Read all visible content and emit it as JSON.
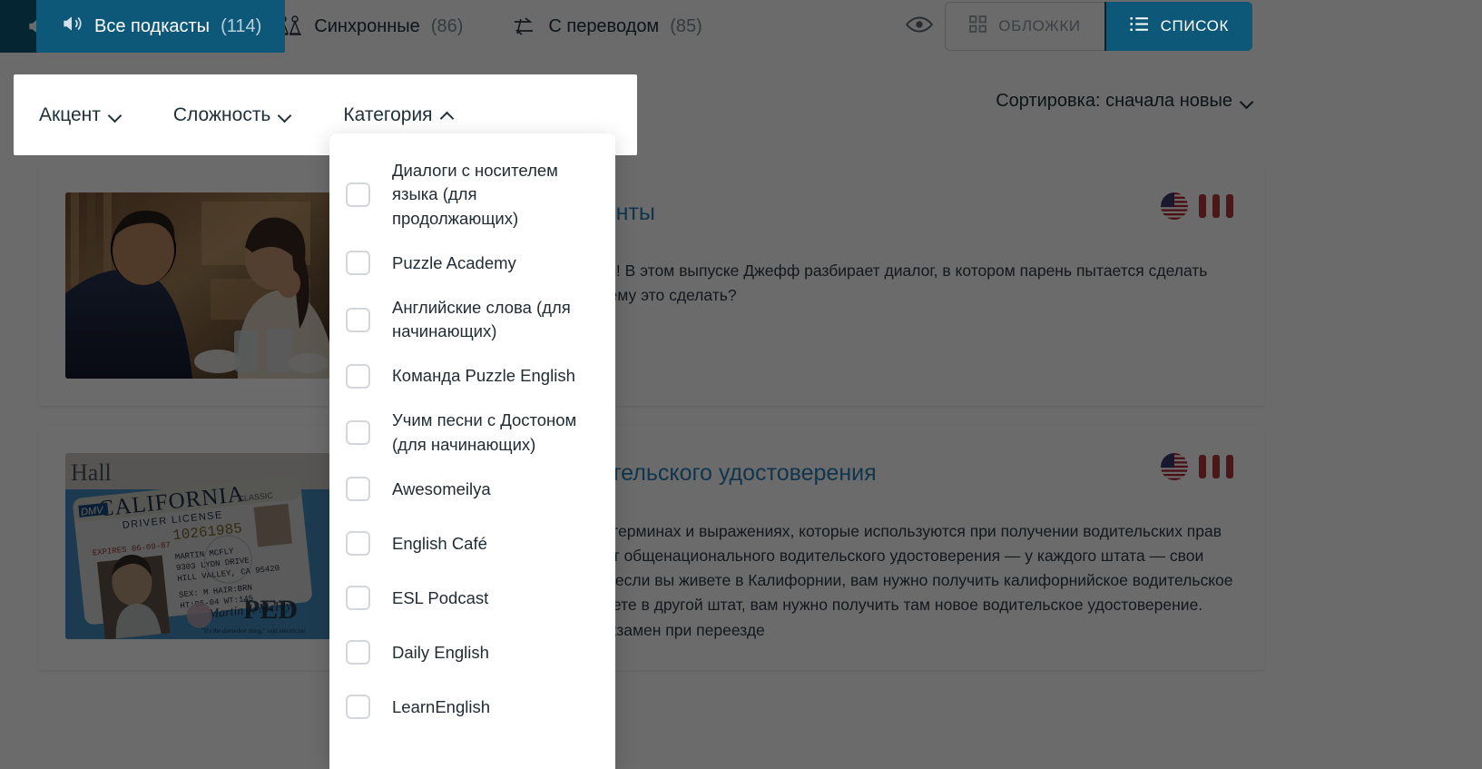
{
  "tabs": [
    {
      "label": "Все подкасты",
      "count": "(114)",
      "icon": "speaker-icon",
      "active": true
    },
    {
      "label": "Синхронные",
      "count": "(86)",
      "icon": "sync-people-icon",
      "active": false
    },
    {
      "label": "С переводом",
      "count": "(85)",
      "icon": "translate-arrows-icon",
      "active": false
    }
  ],
  "toolbar": {
    "eye_icon": "eye-icon",
    "covers_label": "ОБЛОЖКИ",
    "covers_icon": "grid-icon",
    "list_label": "СПИСОК",
    "list_icon": "list-icon"
  },
  "filters": [
    {
      "label": "Акцент",
      "state": "collapsed"
    },
    {
      "label": "Сложность",
      "state": "collapsed"
    },
    {
      "label": "Категория",
      "state": "expanded"
    }
  ],
  "sort": {
    "label": "Сортировка: сначала новые"
  },
  "category_dropdown": {
    "items": [
      {
        "label": "Диалоги с носителем языка (для продолжающих)",
        "checked": false
      },
      {
        "label": "Puzzle Academy",
        "checked": false
      },
      {
        "label": "Английские слова (для начинающих)",
        "checked": false
      },
      {
        "label": "Команда Puzzle English",
        "checked": false
      },
      {
        "label": "Учим песни с Достоном (для начинающих)",
        "checked": false
      },
      {
        "label": "Awesomeilya",
        "checked": false
      },
      {
        "label": "English Café",
        "checked": false
      },
      {
        "label": "ESL Podcast",
        "checked": false
      },
      {
        "label": "Daily English",
        "checked": false
      },
      {
        "label": "LearnEnglish",
        "checked": false
      }
    ]
  },
  "cards": [
    {
      "title_visible": "й день: Делая комплименты",
      "description": "слышать комплимент в свой адрес! В этом выпуске Джефф разбирает диалог, в котором парень пытается сделать комплимент девушке. Удастся ли ему это сделать?",
      "flag": "us-flag-icon",
      "level_bars": 3,
      "thumb_alt": "couple-in-cafe-photo"
    },
    {
      "title_visible": "й день: Получение водительского удостоверения",
      "description": "В этом выпуске рассказывается о терминах и выражениях, которые используются при получении водительских прав в США. В Соединенных Штатах нет общенационального водительского удостоверения — у каждого штата — свои водительские удостоверения. Так, если вы живете в Калифорнии, вам нужно получить калифорнийское водительское удостоверение. Если вы переезжаете в другой штат, вам нужно получить там новое водительское удостоверение. Иногда нужно сдавать еще один экзамен при переезде",
      "flag": "us-flag-icon",
      "level_bars": 3,
      "thumb_alt": "california-driver-license-photo"
    }
  ],
  "colors": {
    "accent": "#0d5878",
    "link": "#2a7fb8",
    "level_bar": "#b03a3a",
    "overlay": "rgba(0,0,0,.58)"
  }
}
